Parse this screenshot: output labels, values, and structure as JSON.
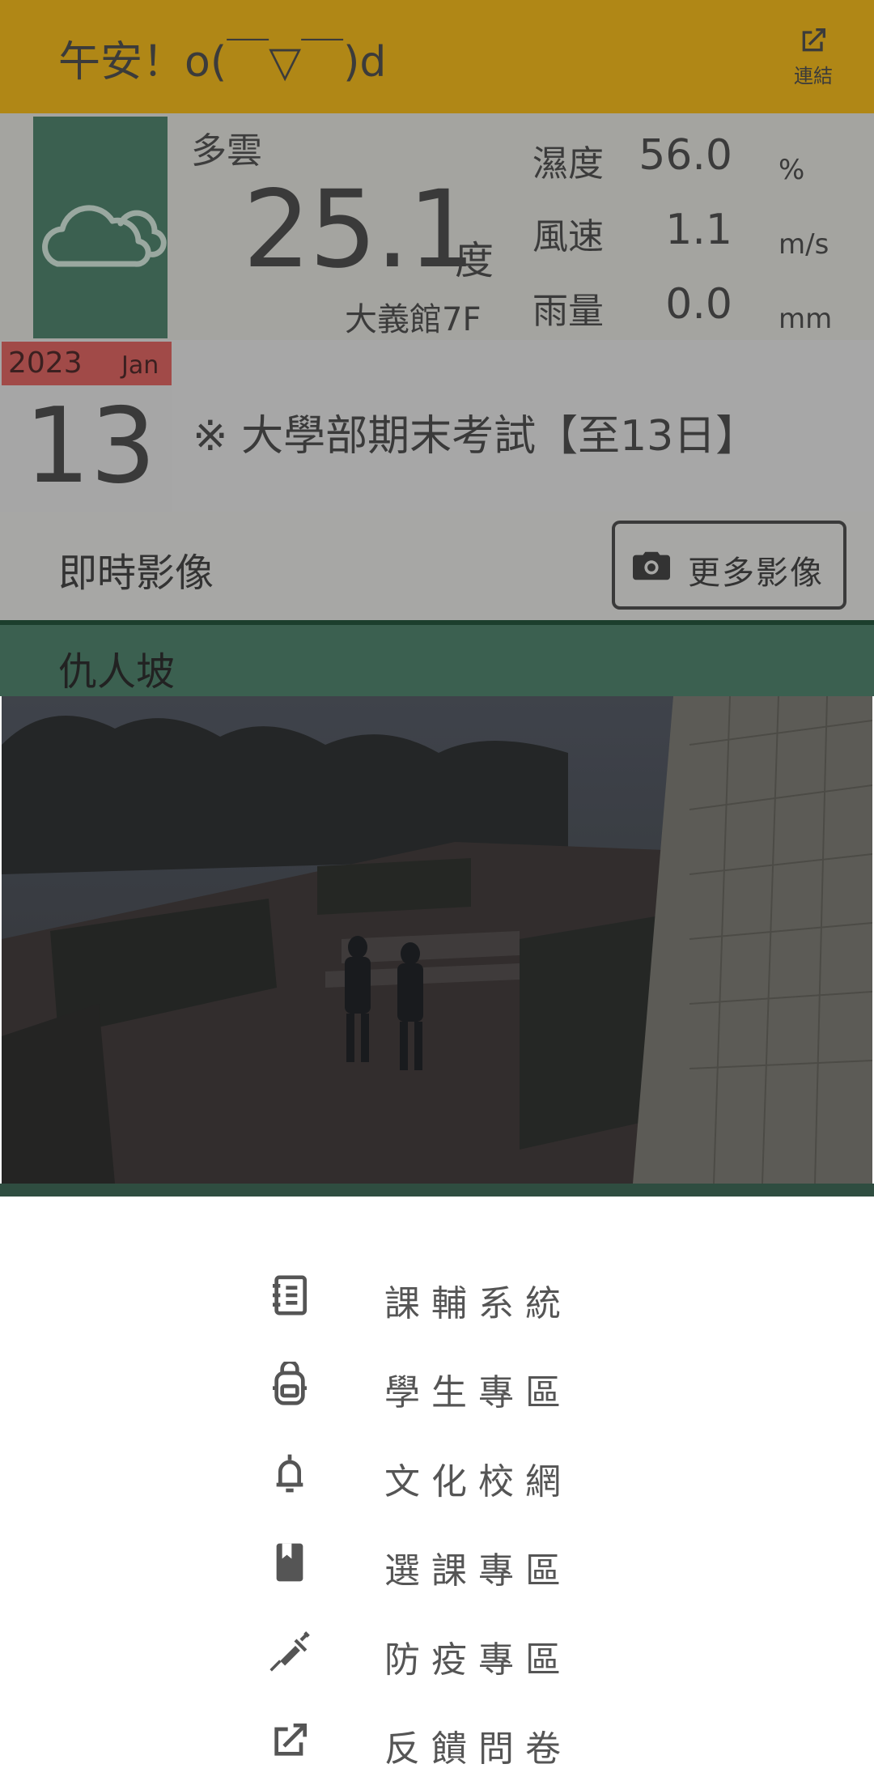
{
  "header": {
    "greeting": "午安！o(￣▽￣)d",
    "link_label": "連結"
  },
  "weather": {
    "condition": "多雲",
    "temperature": "25.1",
    "temperature_unit": "度",
    "station": "大義館7F",
    "humidity_label": "濕度",
    "humidity_value": "56.0",
    "humidity_unit": "%",
    "wind_label": "風速",
    "wind_value": "1.1",
    "wind_unit": "m/s",
    "rain_label": "雨量",
    "rain_value": "0.0",
    "rain_unit": "mm",
    "icon": "cloud-icon"
  },
  "calendar": {
    "year": "2023",
    "month": "Jan",
    "day": "13",
    "event": "※ 大學部期末考試【至13日】"
  },
  "live": {
    "title": "即時影像",
    "more_button": "更多影像",
    "camera_name": "仇人坡"
  },
  "menu": {
    "items": [
      {
        "label": "課輔系統",
        "icon": "notebook-icon"
      },
      {
        "label": "學生專區",
        "icon": "backpack-icon"
      },
      {
        "label": "文化校網",
        "icon": "bell-icon"
      },
      {
        "label": "選課專區",
        "icon": "bookmark-book-icon"
      },
      {
        "label": "防疫專區",
        "icon": "syringe-icon"
      },
      {
        "label": "反饋問卷",
        "icon": "external-link-icon"
      }
    ]
  },
  "colors": {
    "header": "#b08716",
    "weather_icon_box": "#3b6050",
    "date_header": "#a14a48",
    "camera_title_bar": "#3b6050",
    "overlay_dim": "#000000"
  }
}
